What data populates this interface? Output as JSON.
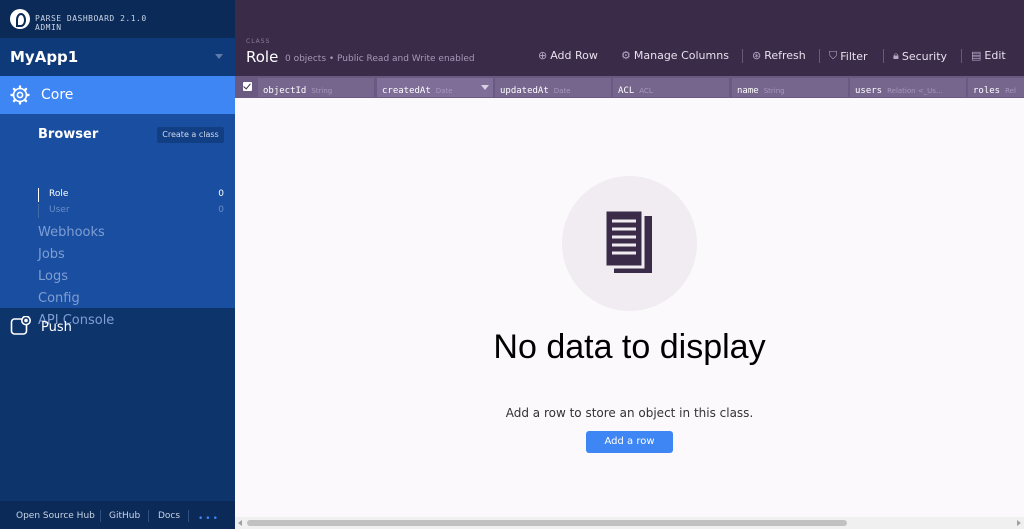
{
  "brand": {
    "line1": "PARSE DASHBOARD 2.1.0",
    "line2": "ADMIN"
  },
  "app": {
    "name": "MyApp1"
  },
  "nav": {
    "core_label": "Core",
    "browser_label": "Browser",
    "create_class_label": "Create a class",
    "classes": [
      {
        "name": "Role",
        "count": "0"
      },
      {
        "name": "User",
        "count": "0"
      }
    ],
    "links": [
      "Webhooks",
      "Jobs",
      "Logs",
      "Config",
      "API Console"
    ],
    "push_label": "Push"
  },
  "footer": {
    "links": [
      "Open Source Hub",
      "GitHub",
      "Docs"
    ],
    "more": "•••"
  },
  "header": {
    "caption": "CLASS",
    "class_name": "Role",
    "meta": "0 objects • Public Read and Write enabled",
    "buttons": {
      "add_row": "Add Row",
      "manage_columns": "Manage Columns",
      "refresh": "Refresh",
      "filter": "Filter",
      "security": "Security",
      "edit": "Edit"
    }
  },
  "columns": [
    {
      "name": "objectId",
      "type": "String"
    },
    {
      "name": "createdAt",
      "type": "Date"
    },
    {
      "name": "updatedAt",
      "type": "Date"
    },
    {
      "name": "ACL",
      "type": "ACL"
    },
    {
      "name": "name",
      "type": "String"
    },
    {
      "name": "users",
      "type": "Relation <_Us..."
    },
    {
      "name": "roles",
      "type": "Rel"
    }
  ],
  "empty": {
    "title": "No data to display",
    "description": "Add a row to store an object in this class.",
    "button": "Add a row"
  },
  "colors": {
    "accent": "#3e86f4",
    "sidebar": "#0e346c",
    "header": "#3a2c48"
  }
}
